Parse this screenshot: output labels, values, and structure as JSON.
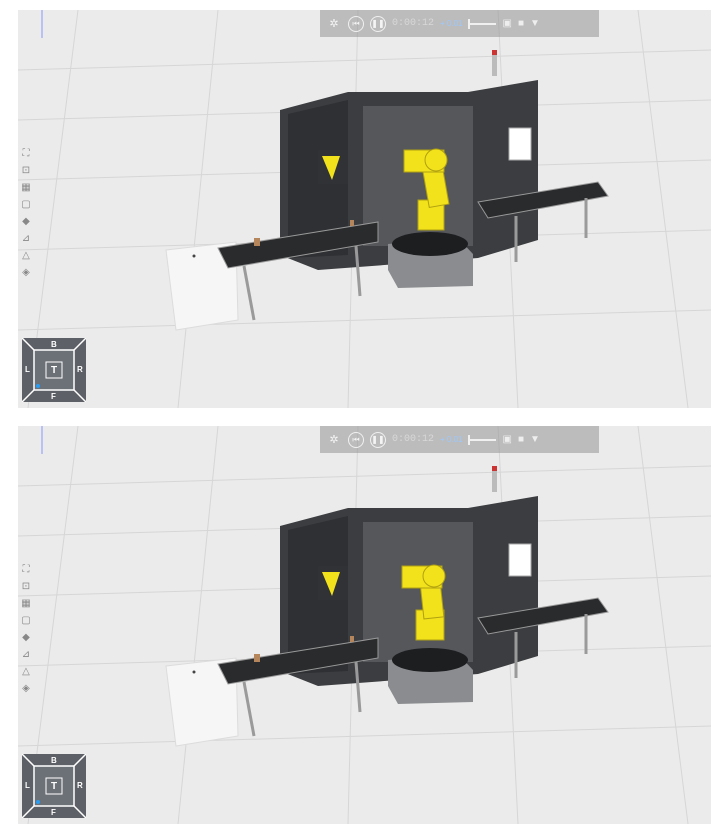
{
  "panels": [
    {
      "id": "top"
    },
    {
      "id": "bottom"
    }
  ],
  "toolbar": {
    "time": "0:00:12",
    "speed": "+ 0.01"
  },
  "navcube": {
    "back": "B",
    "left": "L",
    "top": "T",
    "right": "R",
    "front": "F"
  },
  "side_tools": [
    "fit-view-icon",
    "zoom-box-icon",
    "grid-icon",
    "cube-icon",
    "color-icon",
    "measure-icon",
    "section-icon",
    "layers-icon"
  ],
  "colors": {
    "background": "#ebebeb",
    "robot": "#f2e21b",
    "cell_housing": "#3b3d40",
    "accent": "#2a9df4"
  }
}
